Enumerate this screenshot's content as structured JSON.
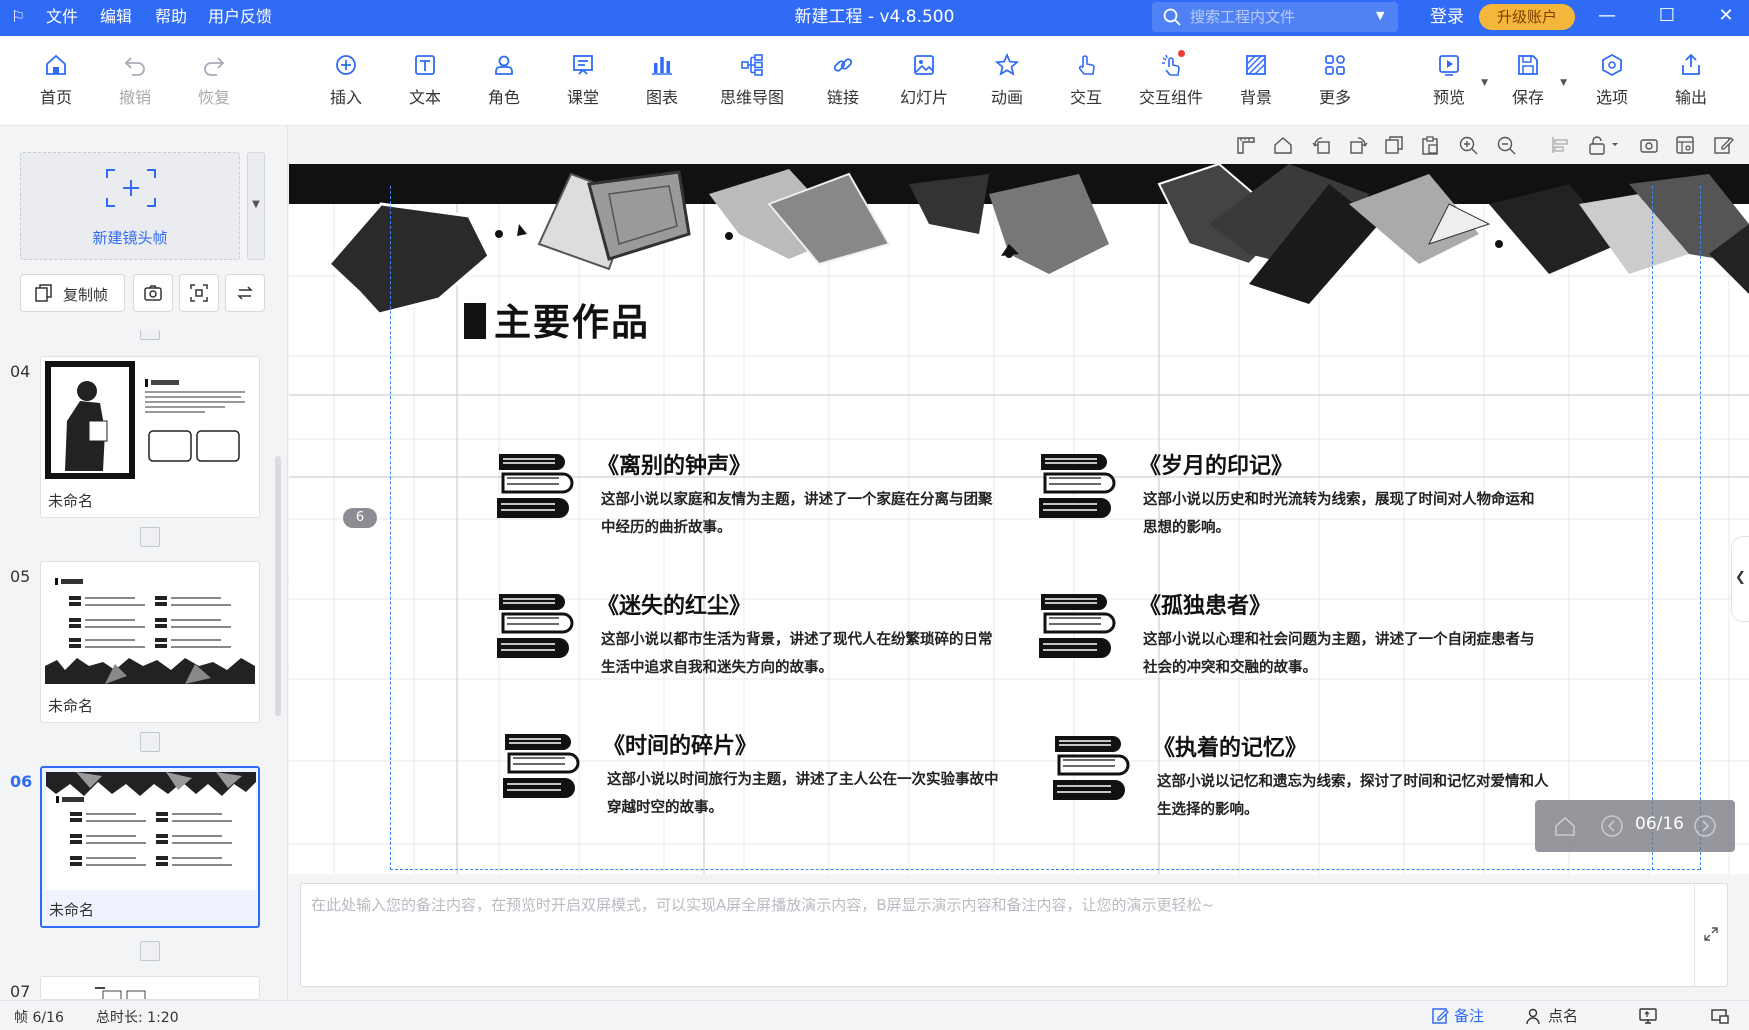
{
  "titlebar": {
    "menus": [
      "文件",
      "编辑",
      "帮助",
      "用户反馈"
    ],
    "app_title": "新建工程 - v4.8.500",
    "search_placeholder": "搜索工程内文件",
    "login": "登录",
    "upgrade": "升级账户"
  },
  "toolbar": {
    "home": "首页",
    "undo": "撤销",
    "redo": "恢复",
    "insert": "插入",
    "text": "文本",
    "role": "角色",
    "classroom": "课堂",
    "chart": "图表",
    "mindmap": "思维导图",
    "link": "链接",
    "slide": "幻灯片",
    "animation": "动画",
    "interact": "交互",
    "interact_component": "交互组件",
    "background": "背景",
    "more": "更多",
    "preview": "预览",
    "save": "保存",
    "options": "选项",
    "export": "输出"
  },
  "leftpanel": {
    "new_frame": "新建镜头帧",
    "copy_frame": "复制帧",
    "thumbnails": [
      {
        "num": "04",
        "name": "未命名",
        "active": false
      },
      {
        "num": "05",
        "name": "未命名",
        "active": false
      },
      {
        "num": "06",
        "name": "未命名",
        "active": true
      },
      {
        "num": "07",
        "name": "",
        "active": false
      }
    ]
  },
  "slide": {
    "heading": "主要作品",
    "page_badge": "6",
    "works": [
      {
        "title": "《离别的钟声》",
        "desc": "这部小说以家庭和友情为主题，讲述了一个家庭在分离与团聚中经历的曲折故事。"
      },
      {
        "title": "《岁月的印记》",
        "desc": "这部小说以历史和时光流转为线索，展现了时间对人物命运和思想的影响。"
      },
      {
        "title": "《迷失的红尘》",
        "desc": "这部小说以都市生活为背景，讲述了现代人在纷繁琐碎的日常生活中追求自我和迷失方向的故事。"
      },
      {
        "title": "《孤独患者》",
        "desc": "这部小说以心理和社会问题为主题，讲述了一个自闭症患者与社会的冲突和交融的故事。"
      },
      {
        "title": "《时间的碎片》",
        "desc": "这部小说以时间旅行为主题，讲述了主人公在一次实验事故中穿越时空的故事。"
      },
      {
        "title": "《执着的记忆》",
        "desc": "这部小说以记忆和遗忘为线索，探讨了时间和记忆对爱情和人生选择的影响。"
      }
    ],
    "nav_count": "06/16"
  },
  "notes": {
    "placeholder": "在此处输入您的备注内容，在预览时开启双屏模式，可以实现A屏全屏播放演示内容，B屏显示演示内容和备注内容，让您的演示更轻松~"
  },
  "statusbar": {
    "frame": "帧 6/16",
    "duration": "总时长: 1:20",
    "notes_btn": "备注",
    "rollcall_btn": "点名"
  },
  "colors": {
    "accent": "#2f6bf4",
    "upgrade": "#f4b73c"
  }
}
